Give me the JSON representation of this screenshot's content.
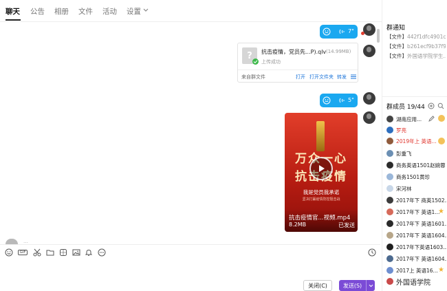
{
  "tabs": [
    {
      "label": "聊天",
      "active": true
    },
    {
      "label": "公告",
      "active": false
    },
    {
      "label": "相册",
      "active": false
    },
    {
      "label": "文件",
      "active": false
    },
    {
      "label": "活动",
      "active": false
    },
    {
      "label": "设置",
      "active": false
    }
  ],
  "header_icons": [
    "phone-icon",
    "screen-share-icon",
    "more-icon"
  ],
  "messages": {
    "voice1": {
      "duration": "7\""
    },
    "file": {
      "name": "抗击疫情，党员先...P).qlv",
      "size": "(14.99MB)",
      "status": "上传成功",
      "source": "来自群文件",
      "action_open": "打开",
      "action_open_folder": "打开文件夹",
      "action_forward": "转发"
    },
    "voice2": {
      "duration": "5\""
    },
    "video": {
      "poster_big_line1": "万众一心",
      "poster_big_line2": "抗击疫情",
      "poster_sub": "我是党员我承诺",
      "poster_small": "坚决打赢疫情防控阻击战",
      "name": "抗击疫情官...视频.mp4",
      "size": "8.2MB",
      "status": "已发送"
    },
    "partial_sender": "…"
  },
  "toolbar_icons": [
    "emoji-icon",
    "gif-icon",
    "scissors-icon",
    "folder-icon",
    "sticker-icon",
    "image-icon",
    "bell-icon",
    "more-circle-icon",
    "history-clock-icon"
  ],
  "gif_label": "GIF",
  "buttons": {
    "close": "关闭(C)",
    "send": "发送(S)"
  },
  "right_panel": {
    "notice_title": "群通知",
    "notices": [
      {
        "label": "【文件】",
        "text": "442f1dfc4901c..."
      },
      {
        "label": "【文件】",
        "text": "b261ecf9b37f9..."
      },
      {
        "label": "【文件】",
        "text": "外国语学院学生..."
      }
    ],
    "members_title": "群成员 19/44",
    "members": [
      {
        "name": "湖南应用...",
        "color": "#222"
      },
      {
        "name": "罗亮",
        "color": "#e0332b"
      },
      {
        "name": "2019年上 英语...",
        "color": "#e0332b"
      },
      {
        "name": "彭重飞",
        "color": "#222"
      },
      {
        "name": "商务英语1501赵婉蓉",
        "color": "#222"
      },
      {
        "name": "商务1501黄珍",
        "color": "#222"
      },
      {
        "name": "宋河林",
        "color": "#222"
      },
      {
        "name": "2017年下 商英1502...",
        "color": "#222"
      },
      {
        "name": "2017年下 英语1...",
        "color": "#222"
      },
      {
        "name": "2017年下 英语1601...",
        "color": "#222"
      },
      {
        "name": "2017年下 英语1604...",
        "color": "#222"
      },
      {
        "name": "2017年下英语1603...",
        "color": "#222"
      },
      {
        "name": "2017年下 英语1604...",
        "color": "#222"
      },
      {
        "name": "2017上 英语16...",
        "color": "#222"
      },
      {
        "name": "外国语学院",
        "color": "#222"
      }
    ]
  }
}
